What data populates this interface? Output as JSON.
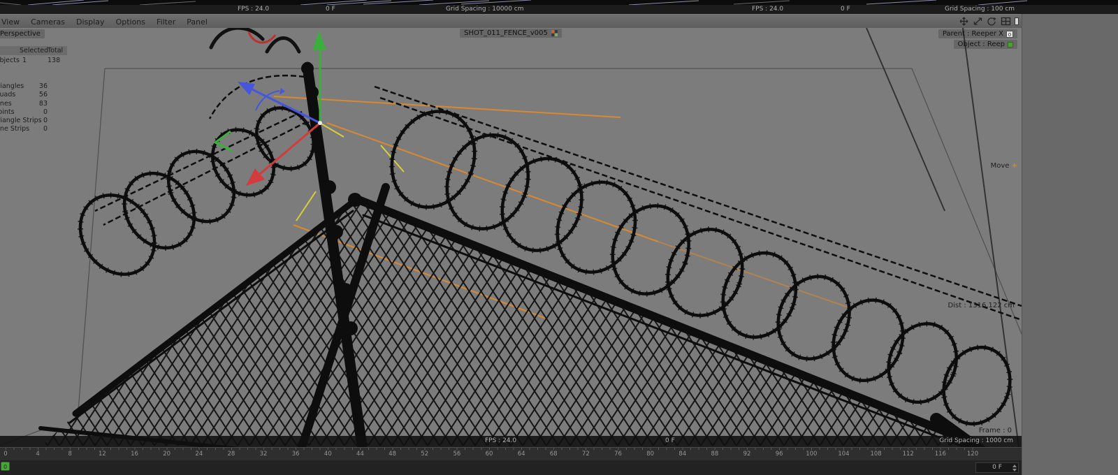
{
  "top_views": {
    "left": {
      "fps": "FPS : 24.0",
      "frame": "0 F",
      "grid": "Grid Spacing : 10000 cm"
    },
    "right": {
      "fps": "FPS : 24.0",
      "frame": "0 F",
      "grid": "Grid Spacing : 100 cm"
    }
  },
  "menu": {
    "items": [
      "View",
      "Cameras",
      "Display",
      "Options",
      "Filter",
      "Panel"
    ]
  },
  "viewport": {
    "camera_label": "Perspective",
    "scene_chip": "SHOT_011_FENCE_v005",
    "parent_label": "Parent : Reeper X",
    "parent_badge": "0",
    "object_label": "Object : Reep",
    "tool_label": "Move",
    "tool_glyph": "+",
    "dist_label": "Dist : 1316.122 cm",
    "frame_label": "Frame : 0",
    "bottom_bar": {
      "fps": "FPS : 24.0",
      "frame": "0 F",
      "grid": "Grid Spacing : 1000 cm"
    },
    "hud": {
      "selected_header": "Selected",
      "total_header": "Total",
      "objects_label": "Objects",
      "objects_selected": "1",
      "objects_total": "138",
      "stats": [
        {
          "label": "Triangles",
          "value": "36"
        },
        {
          "label": "Quads",
          "value": "56"
        },
        {
          "label": "Lines",
          "value": "83"
        },
        {
          "label": "Points",
          "value": "0"
        },
        {
          "label": "Triangle Strips",
          "value": "0"
        },
        {
          "label": "Line Strips",
          "value": "0"
        }
      ]
    }
  },
  "timeline": {
    "ticks": [
      0,
      4,
      8,
      12,
      16,
      20,
      24,
      28,
      32,
      36,
      40,
      44,
      48,
      52,
      56,
      60,
      64,
      68,
      72,
      76,
      80,
      84,
      88,
      92,
      96,
      100,
      104,
      108,
      112,
      116,
      120
    ],
    "marker_label": "0",
    "frame_field": "0 F"
  },
  "colors": {
    "accent_orange": "#d9892f",
    "axis_green": "#3cae3d",
    "axis_red": "#d23c3c",
    "axis_blue": "#4656dd",
    "marker_green": "#4aa33c"
  }
}
